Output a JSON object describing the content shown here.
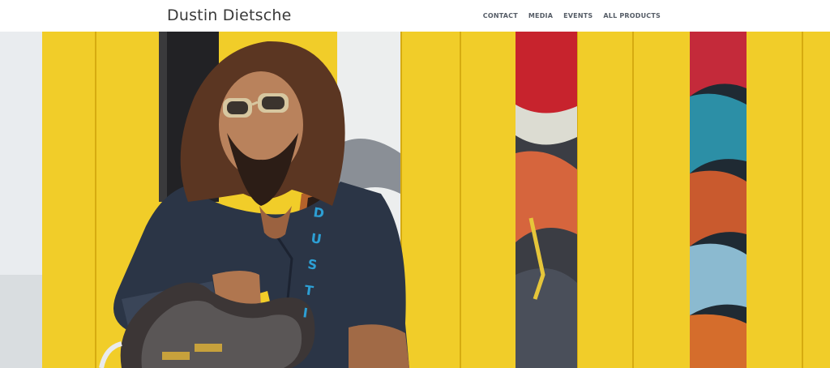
{
  "header": {
    "site_title": "Dustin Dietsche",
    "nav": [
      {
        "label": "CONTACT"
      },
      {
        "label": "MEDIA"
      },
      {
        "label": "EVENTS"
      },
      {
        "label": "ALL PRODUCTS"
      }
    ]
  },
  "hero": {
    "strap_text": "DUSTI",
    "accent": "#f6d21e"
  }
}
